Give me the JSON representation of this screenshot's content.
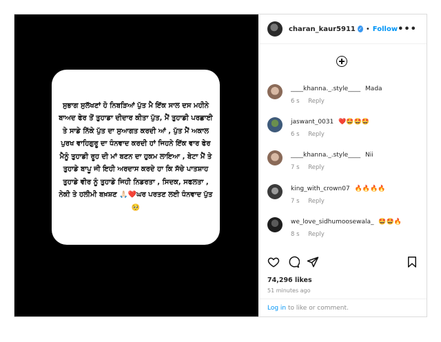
{
  "post": {
    "caption_text": "ਸੁਭਾਗ ਸੁਲੱਖਣਾਂ ਹੋ ਨਿਬੜਿਆਂ ਪੁੱਤ ਮੈ ਇੱਕ ਸਾਲ ਦਸ ਮਹੀਨੇ ਬਾਅਦ ਫੇਰ ਤੋਂ ਤੁਹਾਡਾ ਦੀਦਾਰ ਕੀਤਾ ਪੁੱਤ, ਮੈਂ ਤੁਹਾਡੀ ਪਰਛਾਈ ਤੇ ਸਾਡੇ ਨਿੱਕੇ ਪੁੱਤ ਦਾ ਸੁਆਗਤ ਕਰਦੀ ਆਂ , ਪੁੱਤ ਮੈਂ ਅਕਾਲ ਪੁਰਖ ਵਾਹਿਗੁਰੂ ਦਾ ਧੰਨਵਾਦ ਕਰਦੀ ਹਾਂ ਜਿਹਨੇ ਇੱਕ ਵਾਰ ਫੇਰ ਮੈਨੂੰ ਤੁਹਾਡੀ ਰੂਹ ਦੀ ਮਾਂ ਬਣਨ ਦਾ ਹੁਕਮ ਲਾਇਆ , ਬੇਟਾ ਮੈਂ ਤੇ ਤੁਹਾਡੇ ਬਾਪੂ ਜੀ ਇਹੀ ਅਰਦਾਸ ਕਰਦੇ ਹਾ ਕਿ ਸੱਚੇ ਪਾਤਸ਼ਾਹ ਤੁਹਾਡੇ ਵੀਰ ਨੂੰ ਤੁਹਾਡੇ ਜਿਹੀ  ਨਿਡਰਤਾ , ਸਿਦਕ, ਸਫਲਤਾ , ਨੇਕੀ ਤੇ ਹਲੀਮੀ ਬਖ਼ਸ਼ਣ 🙏🏻❤️ਘਰ ਪਰਤਣ ਲਈ ਧੰਨਵਾਦ ਪੁੱਤ 🥺"
  },
  "header": {
    "username": "charan_kaur5911",
    "separator": "•",
    "follow_label": "Follow",
    "more_label": "•••",
    "verified_glyph": "✓",
    "accent_color": "#0095f6"
  },
  "comments": [
    {
      "user": "____khanna._.style____",
      "text": "Mada",
      "time": "6 s",
      "reply": "Reply"
    },
    {
      "user": "jaswant_0031",
      "text": "❤️🤩🤩🤩",
      "time": "6 s",
      "reply": "Reply"
    },
    {
      "user": "____khanna._.style____",
      "text": "Nii",
      "time": "7 s",
      "reply": "Reply"
    },
    {
      "user": "king_with_crown07",
      "text": "🔥🔥🔥🔥",
      "time": "7 s",
      "reply": "Reply"
    },
    {
      "user": "we_love_sidhumoosewala_",
      "text": "🤩🤩🔥",
      "time": "8 s",
      "reply": "Reply"
    }
  ],
  "stats": {
    "likes": "74,296 likes",
    "time_ago": "51 minutes ago"
  },
  "login": {
    "link_label": "Log in",
    "suffix": " to like or comment."
  },
  "icons": [
    "heart-icon",
    "comment-icon",
    "share-icon",
    "bookmark-icon",
    "add-circle-icon",
    "verified-icon",
    "more-icon"
  ]
}
